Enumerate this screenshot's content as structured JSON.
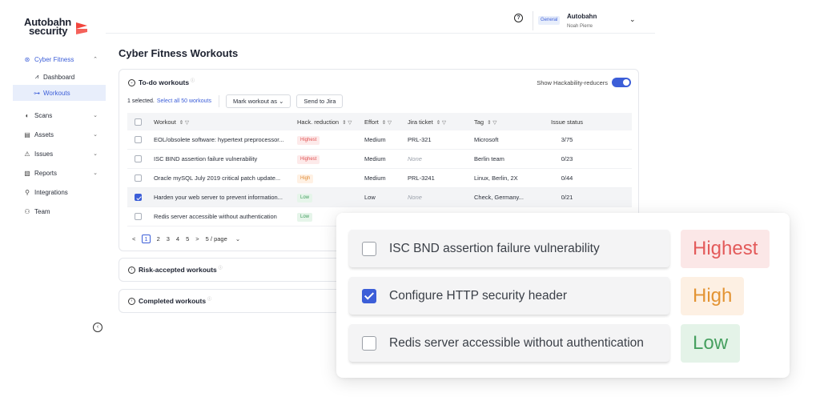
{
  "app": {
    "logo_line1": "Autobahn",
    "logo_line2": "security",
    "accent_color": "#3c5ed8"
  },
  "header": {
    "org_badge": "General",
    "org_name": "Autobahn",
    "user_name": "Noah Pierre"
  },
  "sidebar": {
    "items": [
      {
        "label": "Cyber Fitness",
        "icon": "cyber-fitness-icon"
      },
      {
        "label": "Dashboard",
        "icon": "chart-icon"
      },
      {
        "label": "Workouts",
        "icon": "workouts-icon"
      },
      {
        "label": "Scans",
        "icon": "scans-icon"
      },
      {
        "label": "Assets",
        "icon": "assets-icon"
      },
      {
        "label": "Issues",
        "icon": "issues-icon"
      },
      {
        "label": "Reports",
        "icon": "reports-icon"
      },
      {
        "label": "Integrations",
        "icon": "integrations-icon"
      },
      {
        "label": "Team",
        "icon": "team-icon"
      }
    ]
  },
  "main": {
    "title": "Cyber Fitness Workouts",
    "todo": {
      "title": "To-do workouts",
      "toggle_label": "Show Hackability-reducers",
      "toggle_on": true,
      "selected_text": "1 selected.",
      "select_all": "Select all 50 workouts",
      "mark_button": "Mark workout as",
      "jira_button": "Send to Jira"
    },
    "table": {
      "headers": [
        "Workout",
        "Hack. reduction",
        "Effort",
        "Jira ticket",
        "Tag",
        "Issue status"
      ],
      "rows": [
        {
          "workout": "EOL/obsolete software: hypertext preprocessor...",
          "hack": "Highest",
          "effort": "Medium",
          "jira": "PRL-321",
          "tag": "Microsoft",
          "status": "3/75"
        },
        {
          "workout": "ISC BIND assertion failure vulnerability",
          "hack": "Highest",
          "effort": "Medium",
          "jira": "None",
          "tag": "Berlin team",
          "status": "0/23"
        },
        {
          "workout": "Oracle mySQL July 2019 critical patch update...",
          "hack": "High",
          "effort": "Medium",
          "jira": "PRL-3241",
          "tag": "Linux, Berlin, 2X",
          "status": "0/44"
        },
        {
          "workout": "Harden your web server to prevent information...",
          "hack": "Low",
          "effort": "Low",
          "jira": "None",
          "tag": "Check, Germany...",
          "status": "0/21"
        },
        {
          "workout": "Redis server accessible without authentication",
          "hack": "Low",
          "effort": "",
          "jira": "",
          "tag": "",
          "status": ""
        }
      ]
    },
    "pager": {
      "prev": "<",
      "pages": [
        "1",
        "2",
        "3",
        "4",
        "5"
      ],
      "next": ">",
      "page_size": "5 / page"
    },
    "risk_accepted": "Risk-accepted workouts",
    "completed": "Completed workouts"
  },
  "overlay": {
    "rows": [
      {
        "label": "ISC BND assertion failure vulnerability",
        "checked": false,
        "level": "Highest"
      },
      {
        "label": "Configure HTTP security header",
        "checked": true,
        "level": "High"
      },
      {
        "label": "Redis server accessible without authentication",
        "checked": false,
        "level": "Low"
      }
    ]
  }
}
